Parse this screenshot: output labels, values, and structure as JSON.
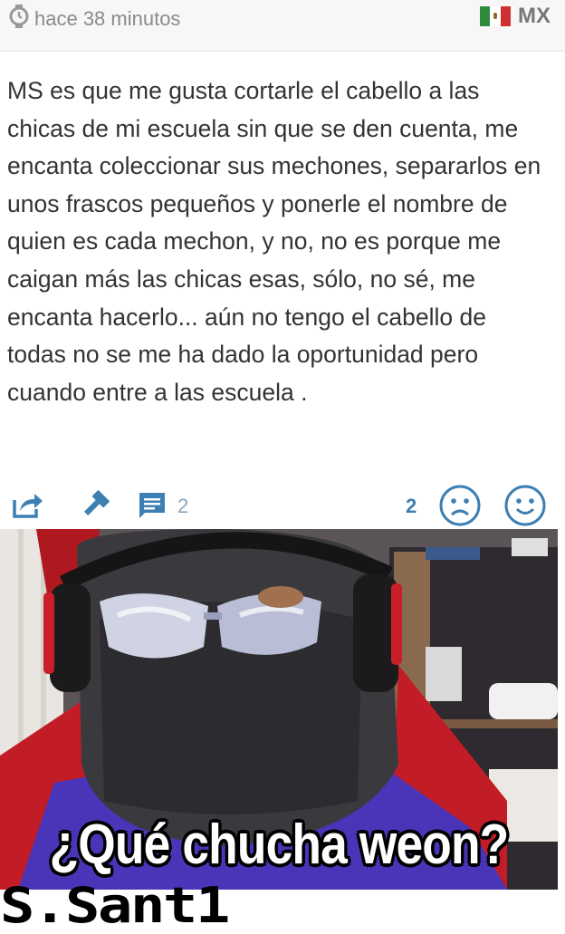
{
  "header": {
    "time_text": "hace 38 minutos",
    "country_code": "MX",
    "flag_colors": [
      "#2f8a3e",
      "#ffffff",
      "#ce2f2f"
    ],
    "icons": {
      "time": "stopwatch-icon",
      "flag": "mexico-flag-icon"
    }
  },
  "post": {
    "text": "MS es que me gusta cortarle el cabello a las chicas de mi escuela sin que se den cuenta, me encanta coleccionar sus mechones, separarlos en unos frascos pequeños y ponerle el nombre de quien es cada mechon, y no, no es porque me caigan más las chicas esas, sólo, no sé,  me encanta hacerlo... aún no tengo el cabello de todas no se me ha dado la oportunidad pero cuando entre a las escuela ."
  },
  "actions": {
    "comment_count": "2",
    "sad_count": "2",
    "accent_color": "#3d7fb3",
    "icons": [
      "share-icon",
      "gavel-icon",
      "comment-icon",
      "sad-face-icon",
      "happy-face-icon"
    ]
  },
  "meme": {
    "caption": "¿Qué chucha weon?"
  },
  "watermark": "S.Sant1"
}
